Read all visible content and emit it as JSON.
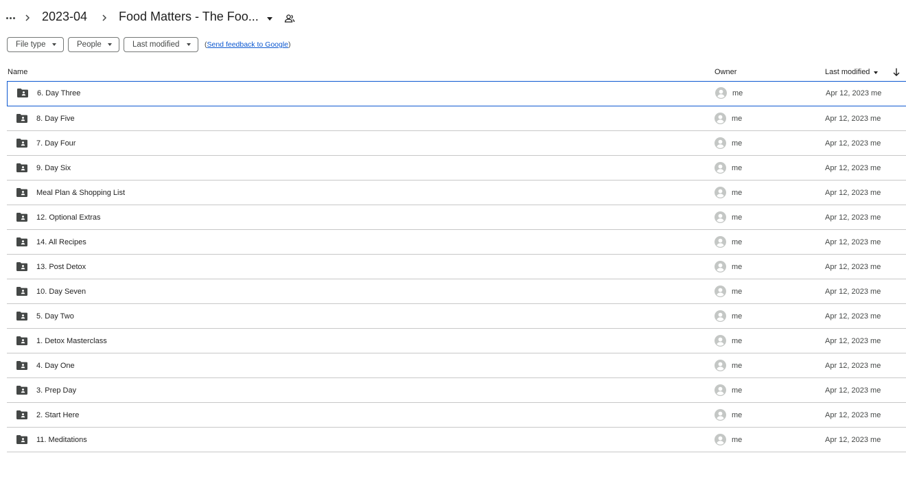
{
  "breadcrumb": {
    "items": [
      "2023-04",
      "Food Matters - The Foo..."
    ]
  },
  "filters": {
    "file_type": "File type",
    "people": "People",
    "last_modified": "Last modified",
    "feedback_prefix": "(",
    "feedback_link": "Send feedback to Google",
    "feedback_suffix": ")"
  },
  "columns": {
    "name": "Name",
    "owner": "Owner",
    "last_modified": "Last modified"
  },
  "files": [
    {
      "name": "6. Day Three",
      "owner": "me",
      "modified": "Apr 12, 2023 me"
    },
    {
      "name": "8. Day Five",
      "owner": "me",
      "modified": "Apr 12, 2023 me"
    },
    {
      "name": "7. Day Four",
      "owner": "me",
      "modified": "Apr 12, 2023 me"
    },
    {
      "name": "9. Day Six",
      "owner": "me",
      "modified": "Apr 12, 2023 me"
    },
    {
      "name": "Meal Plan & Shopping List",
      "owner": "me",
      "modified": "Apr 12, 2023 me"
    },
    {
      "name": "12. Optional Extras",
      "owner": "me",
      "modified": "Apr 12, 2023 me"
    },
    {
      "name": "14. All Recipes",
      "owner": "me",
      "modified": "Apr 12, 2023 me"
    },
    {
      "name": "13. Post Detox",
      "owner": "me",
      "modified": "Apr 12, 2023 me"
    },
    {
      "name": "10. Day Seven",
      "owner": "me",
      "modified": "Apr 12, 2023 me"
    },
    {
      "name": "5. Day Two",
      "owner": "me",
      "modified": "Apr 12, 2023 me"
    },
    {
      "name": "1. Detox Masterclass",
      "owner": "me",
      "modified": "Apr 12, 2023 me"
    },
    {
      "name": "4. Day One",
      "owner": "me",
      "modified": "Apr 12, 2023 me"
    },
    {
      "name": "3. Prep Day",
      "owner": "me",
      "modified": "Apr 12, 2023 me"
    },
    {
      "name": "2. Start Here",
      "owner": "me",
      "modified": "Apr 12, 2023 me"
    },
    {
      "name": "11. Meditations",
      "owner": "me",
      "modified": "Apr 12, 2023 me"
    }
  ],
  "selected_row": 0,
  "icons": {
    "more": "more-horiz-icon",
    "separator": "chevron-right-icon",
    "folder": "shared-folder-icon",
    "avatar": "account-circle-icon",
    "sort": "arrow-down-icon"
  },
  "colors": {
    "accent": "#0b57d0",
    "text": "#1f1f1f",
    "muted": "#444746",
    "divider": "#c7c7c7"
  }
}
